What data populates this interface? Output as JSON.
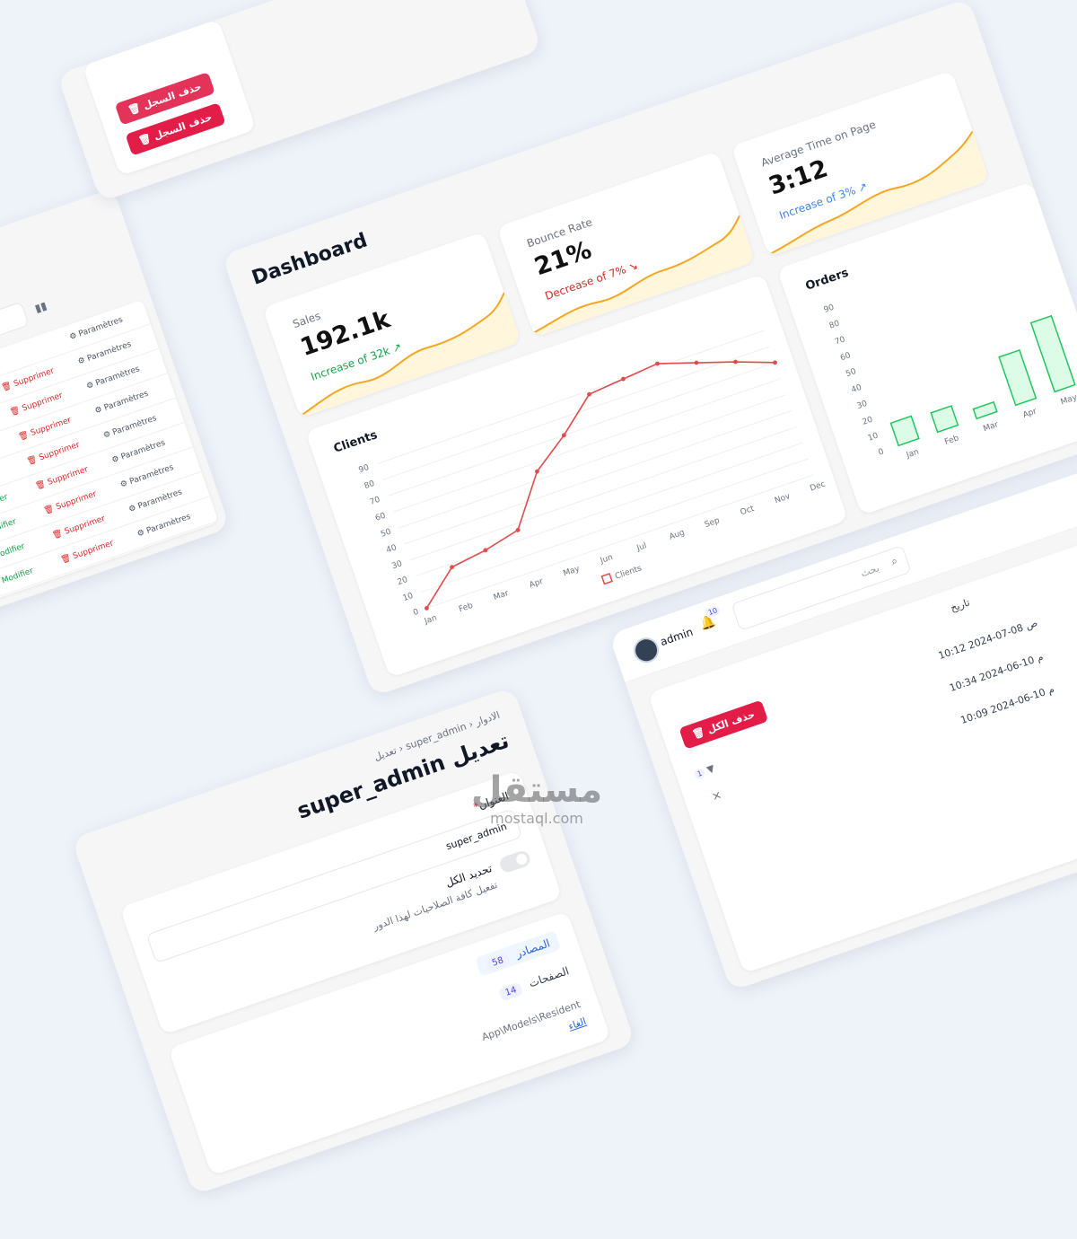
{
  "dashboard": {
    "title": "Dashboard",
    "stats": [
      {
        "label": "Sales",
        "value": "192.1k",
        "trend": "Increase of 32k",
        "direction": "up"
      },
      {
        "label": "Bounce Rate",
        "value": "21%",
        "trend": "Decrease of 7%",
        "direction": "down"
      },
      {
        "label": "Average Time on Page",
        "value": "3:12",
        "trend": "Increase of 3%",
        "direction": "up"
      }
    ],
    "colors": {
      "spark": "#f5a623",
      "spark_fill": "#fff6dc",
      "line": "#e24b4b",
      "bar_border": "#22c55e",
      "bar_fill": "#dcfce7"
    }
  },
  "chart_data": [
    {
      "type": "line",
      "title": "Clients",
      "categories": [
        "Jan",
        "Feb",
        "Mar",
        "Apr",
        "May",
        "Jun",
        "Jul",
        "Aug",
        "Sep",
        "Oct",
        "Nov",
        "Dec"
      ],
      "series": [
        {
          "name": "Clients",
          "values": [
            0,
            18,
            21,
            26,
            55,
            70,
            88,
            90,
            92,
            85,
            78,
            70
          ]
        }
      ],
      "ylim": [
        0,
        90
      ],
      "yticks": [
        "0",
        "10",
        "20",
        "30",
        "40",
        "50",
        "60",
        "70",
        "80",
        "90"
      ],
      "legend": "bottom",
      "grid": true
    },
    {
      "type": "bar",
      "title": "Orders",
      "categories": [
        "Jan",
        "Feb",
        "Mar",
        "Apr",
        "May"
      ],
      "values": [
        14,
        12,
        6,
        30,
        43
      ],
      "ylim": [
        0,
        90
      ],
      "yticks": [
        "0",
        "10",
        "20",
        "30",
        "40",
        "50",
        "60",
        "70",
        "80",
        "90"
      ]
    }
  ],
  "roles_page": {
    "breadcrumb": [
      "الادوار",
      "super_admin",
      "تعديل"
    ],
    "title": "تعديل super_admin",
    "field_label": "العنوان",
    "required_mark": "*",
    "field_value": "super_admin",
    "toggle_label": "تحديد الكل",
    "toggle_help": "تفعيل كافة الصلاحيات لهذا الدور",
    "tabs": [
      {
        "label": "المصادر",
        "count": "58"
      },
      {
        "label": "الصفحات",
        "count": "14"
      }
    ],
    "resource_path": "App\\Models\\Resident",
    "resource_link": "الغاء"
  },
  "log_page": {
    "search_placeholder": "بحث",
    "user": "admin",
    "notification_count": "10",
    "delete_all": "حذف الكل",
    "date_header": "تاريخ",
    "filter_count": "1",
    "close_symbol": "×",
    "rows": [
      "10:12 ص 08-07-2024",
      "10:34 م 10-06-2024",
      "10:09 م 10-06-2024"
    ]
  },
  "top_panel": {
    "delete_record": "حذف السجل"
  },
  "table_panel": {
    "actions": {
      "modify": "Modifier",
      "delete": "Supprimer",
      "settings": "Paramètres"
    }
  },
  "watermark": {
    "arabic": "مستقل",
    "latin": "mostaql.com"
  }
}
